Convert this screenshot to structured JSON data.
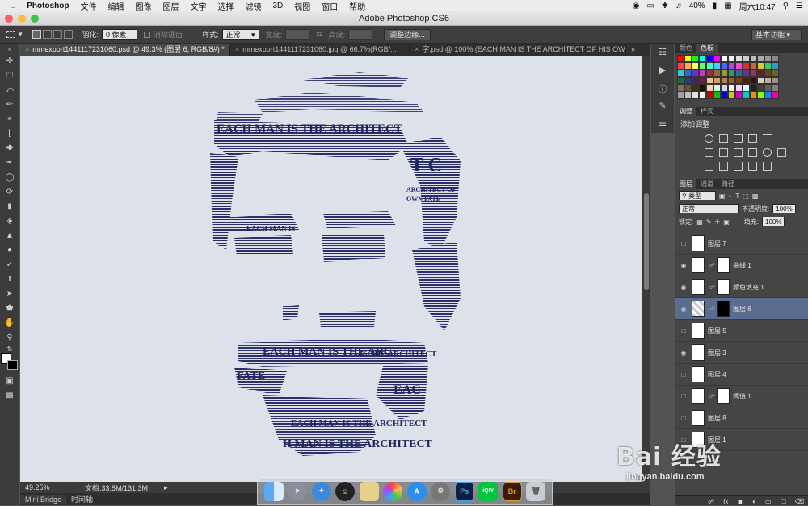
{
  "menubar": {
    "app_name": "Photoshop",
    "items": [
      "文件",
      "编辑",
      "图像",
      "图层",
      "文字",
      "选择",
      "滤镜",
      "3D",
      "视图",
      "窗口",
      "帮助"
    ],
    "battery": "40%",
    "clock": "周六10:47"
  },
  "window": {
    "title": "Adobe Photoshop CS6"
  },
  "options": {
    "feather_label": "羽化:",
    "feather_value": "0 像素",
    "antialias_label": "消除锯齿",
    "style_label": "样式:",
    "style_value": "正常",
    "width_label": "宽度:",
    "height_label": "高度:",
    "refine_button": "调整边缘...",
    "workspace": "基本功能"
  },
  "tabs": [
    "mmexport1441117231060.psd @ 49.3% (图层 6, RGB/8#) *",
    "mmexport1441117231060.jpg @ 66.7%(RGB/...",
    "字.psd @ 100% (EACH MAN IS THE ARCHITECT OF HIS OWN F..."
  ],
  "status": {
    "zoom": "49.25%",
    "doc": "文档:33.5M/131.3M"
  },
  "bottom_tabs": [
    "Mini Bridge",
    "时间轴"
  ],
  "panels": {
    "color_tabs": [
      "颜色",
      "色板"
    ],
    "adjust_tabs": [
      "调整",
      "样式"
    ],
    "adjust_title": "添加调整",
    "layer_tabs": [
      "图层",
      "通道",
      "路径"
    ],
    "kind_label": "类型",
    "blend_mode": "正常",
    "opacity_label": "不透明度:",
    "opacity_value": "100%",
    "lock_label": "锁定:",
    "fill_label": "填充:",
    "fill_value": "100%"
  },
  "layers": [
    {
      "name": "图层 7",
      "visible": false,
      "mask": false,
      "selected": false
    },
    {
      "name": "曲线 1",
      "visible": true,
      "mask": true,
      "selected": false
    },
    {
      "name": "颜色填充 1",
      "visible": true,
      "mask": true,
      "selected": false
    },
    {
      "name": "图层 6",
      "visible": true,
      "mask": true,
      "selected": true
    },
    {
      "name": "图层 5",
      "visible": false,
      "mask": false,
      "selected": false
    },
    {
      "name": "图层 3",
      "visible": true,
      "mask": false,
      "selected": false
    },
    {
      "name": "图层 4",
      "visible": false,
      "mask": false,
      "selected": false
    },
    {
      "name": "阈值 1",
      "visible": false,
      "mask": true,
      "selected": false
    },
    {
      "name": "图层 8",
      "visible": false,
      "mask": false,
      "selected": false
    },
    {
      "name": "图层 1",
      "visible": false,
      "mask": false,
      "selected": false
    }
  ],
  "canvas_text": {
    "line1": "EACH MAN IS THE ARCHITECT",
    "line2": "T C",
    "line3": "ARCHITECT OF",
    "line4": "OWN FATE",
    "line5": "EACH MAN IS",
    "line6": "EACH MAN IS THE ARC",
    "line7": "IS THE ARCHITECT",
    "line8": "FATE",
    "line9": "EAC",
    "line10": "EACH MAN IS THE ARCHITECT",
    "line11": "H MAN IS THE ARCHITECT"
  },
  "dock_apps": [
    "Finder",
    "Launchpad",
    "Safari",
    "QQ",
    "Preview",
    "Photos",
    "App Store",
    "System Preferences",
    "Ps",
    "iQIYI",
    "Br",
    "Trash"
  ],
  "watermark": {
    "big": "Bai 经验",
    "small": "jingyan.baidu.com"
  },
  "colors": {
    "canvas_bg": "#dde2ea",
    "ink": "#2a2f6a",
    "selected_layer": "#5b6d8e"
  }
}
